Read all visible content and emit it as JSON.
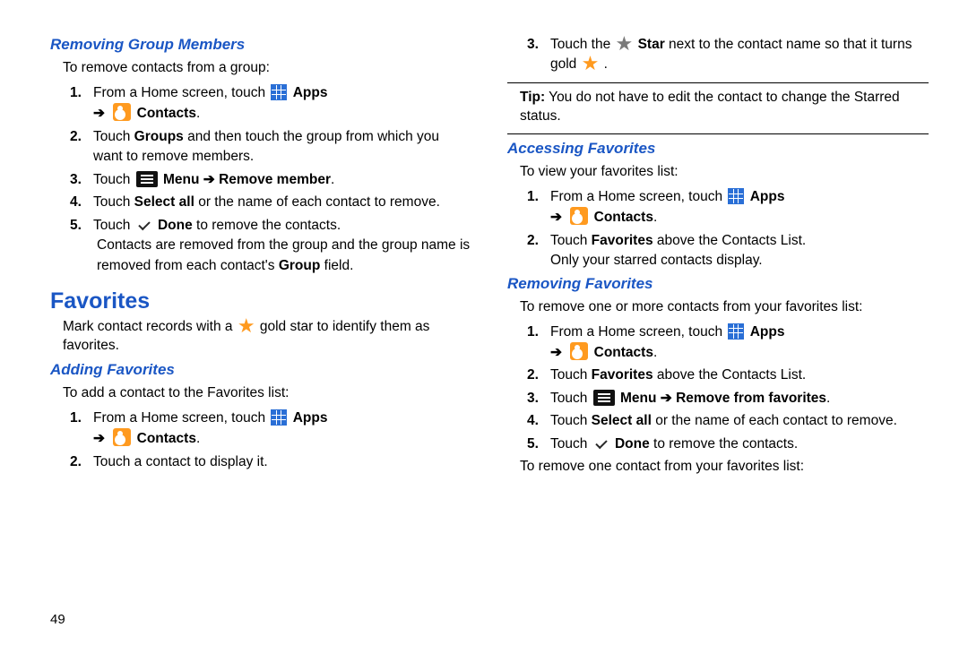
{
  "left": {
    "h_removing_group": "Removing Group Members",
    "intro1": "To remove contacts from a group:",
    "step1_a": "From a Home screen, touch ",
    "apps_label": "Apps",
    "contacts_label": "Contacts",
    "step2": "Touch ",
    "step2_b": "Groups",
    "step2_c": " and then touch the group from which you want to remove members.",
    "step3_a": "Touch ",
    "step3_menu": "Menu",
    "step3_arrow": " ➔ ",
    "step3_remove": "Remove member",
    "step4_a": "Touch ",
    "step4_b": "Select all",
    "step4_c": " or the name of each contact to remove.",
    "step5_a": "Touch ",
    "step5_done": "Done",
    "step5_c": " to remove the contacts.",
    "step5_note": "Contacts are removed from the group and the group name is removed from each contact's ",
    "step5_note_b": "Group",
    "step5_note_c": " field.",
    "h_favorites": "Favorites",
    "fav_intro_a": "Mark contact records with a ",
    "fav_intro_b": " gold star to identify them as favorites.",
    "h_adding": "Adding Favorites",
    "add_intro": "To add a contact to the Favorites list:",
    "add_step2": "Touch a contact to display it."
  },
  "right": {
    "r3_a": "Touch the ",
    "r3_star": "Star",
    "r3_b": " next to the contact name so that it turns gold ",
    "tip_label": "Tip:",
    "tip_text": " You do not have to edit the contact to change the Starred status.",
    "h_accessing": "Accessing Favorites",
    "acc_intro": "To view your favorites list:",
    "acc_step2_a": "Touch ",
    "acc_step2_b": "Favorites",
    "acc_step2_c": " above the Contacts List.",
    "acc_step2_note": "Only your starred contacts display.",
    "h_removing_fav": "Removing Favorites",
    "rem_intro": "To remove one or more contacts from your favorites list:",
    "rem_step3_remove": "Remove from favorites",
    "rem_trailer": "To remove one contact from your favorites list:"
  },
  "page_number": "49"
}
